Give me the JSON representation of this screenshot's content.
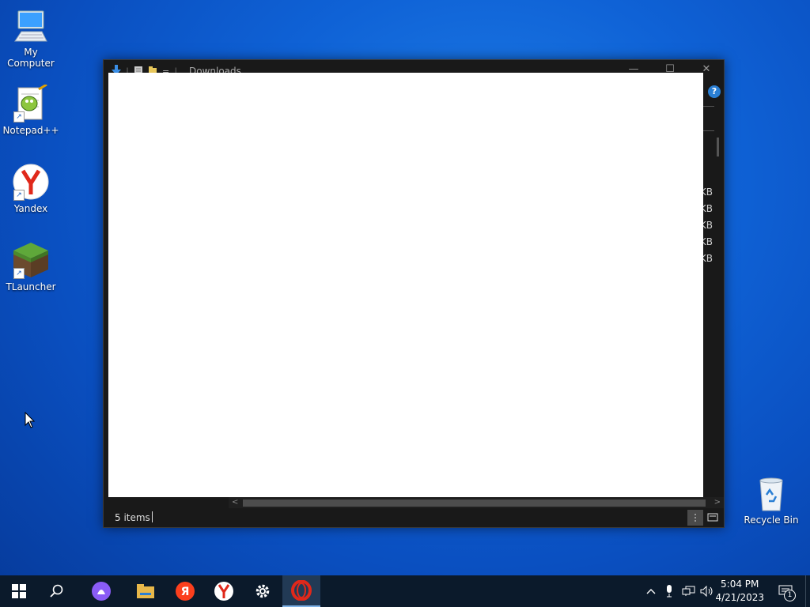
{
  "desktop": {
    "icons": [
      {
        "label": "My Computer",
        "icon": "computer-icon"
      },
      {
        "label": "Notepad++",
        "icon": "notepadpp-icon"
      },
      {
        "label": "Yandex",
        "icon": "yandex-browser-icon"
      },
      {
        "label": "TLauncher",
        "icon": "tlauncher-icon"
      }
    ],
    "recycle_bin": {
      "label": "Recycle Bin",
      "icon": "recycle-bin-icon"
    }
  },
  "explorer": {
    "title": "Downloads",
    "help_glyph": "?",
    "size_cells": [
      "KB",
      "KB",
      "KB",
      "KB",
      "KB"
    ],
    "status_text": "5 items"
  },
  "taskbar": {
    "buttons": [
      "start-icon",
      "search-icon",
      "alice-icon",
      "file-explorer-icon",
      "yandex-icon",
      "yandex-browser-icon",
      "settings-icon",
      "opera-icon"
    ],
    "active": "opera-icon",
    "tray": [
      "chevron-up-icon",
      "microphone-icon",
      "network-icon",
      "volume-icon"
    ],
    "time": "5:04 PM",
    "date": "4/21/2023",
    "notification_count": "1"
  },
  "colors": {
    "accent": "#0f62d6",
    "taskbar": "#0b1a2b",
    "window_dark": "#191919",
    "opera_red": "#e0281a",
    "yandex_red": "#fc3f1d"
  }
}
